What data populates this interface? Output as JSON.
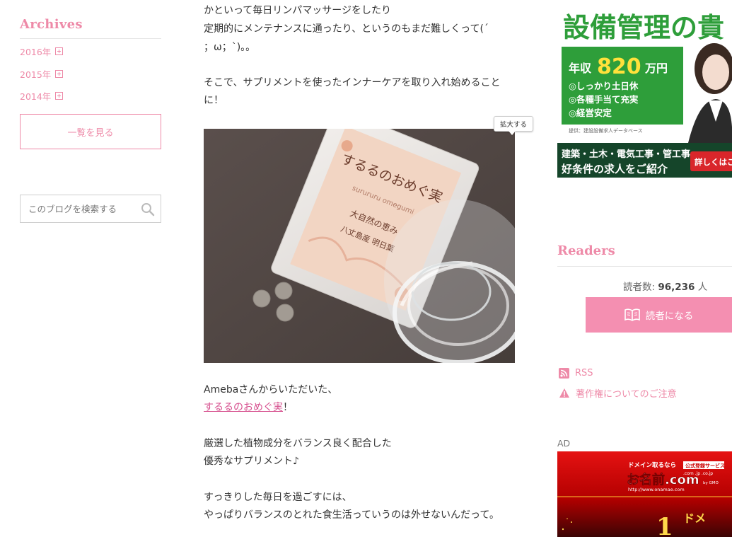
{
  "sidebar": {
    "archives_title": "Archives",
    "years": [
      {
        "label": "2016年"
      },
      {
        "label": "2015年"
      },
      {
        "label": "2014年"
      }
    ],
    "view_all_label": "一覧を見る",
    "search_placeholder": "このブログを検索する"
  },
  "article": {
    "lines_top": [
      "かといって毎日リンパマッサージをしたり",
      "定期的にメンテナンスに通ったり、というのもまだ難しくって(´",
      "；ω；`)。。",
      "そこで、サプリメントを使ったインナーケアを取り入れ始めること",
      "に！"
    ],
    "enlarge_label": "拡大する",
    "photo": {
      "package_title": "するるのおめぐ実",
      "package_sub": "surururu omegumi",
      "package_text_1": "大自然の恵み",
      "package_text_2": "八丈島産 明日葉"
    },
    "line_ameba": "Amebaさんからいただいた、",
    "product_link": "するるのおめぐ実",
    "line_after_link": "！",
    "line_select_1": "厳選した植物成分をバランス良く配合した",
    "line_select_2": "優秀なサプリメント♪",
    "line_daily_1": "すっきりした毎日を過ごすには、",
    "line_daily_2": "やっぱりバランスのとれた食生活っていうのは外せないんだって。"
  },
  "banner": {
    "headline": "設備管理の貴",
    "salary_prefix": "年収",
    "salary_value": "820",
    "salary_unit": "万円",
    "bullets": [
      "◎しっかり土日休",
      "◎各種手当て充実",
      "◎経営安定"
    ],
    "provider": "提供：建設設備求人データベース",
    "footer_line_1": "建築・土木・電気工事・管工事",
    "footer_line_2": "好条件の求人をご紹介",
    "cta": "詳しくはこ"
  },
  "readers": {
    "title": "Readers",
    "count_label": "読者数:",
    "count_value": "96,236",
    "count_unit": "人",
    "follow_label": "読者になる"
  },
  "links": {
    "rss": "RSS",
    "copyright": "著作権についてのご注意"
  },
  "ad": {
    "label": "AD",
    "top_text": "ドメイン取るなら",
    "badge": "公式登録サービス",
    "tlds": ".com .jp .co.jp",
    "brand": "お名前.com",
    "by": "by GMO",
    "url": "http://www.onamae.com",
    "big_num": "1",
    "side_char": "ドメ"
  },
  "colors": {
    "pink": "#ee8aa8",
    "button_pink": "#f48fb1",
    "link_pink": "#d64f8e",
    "banner_green": "#2e9e3a"
  }
}
